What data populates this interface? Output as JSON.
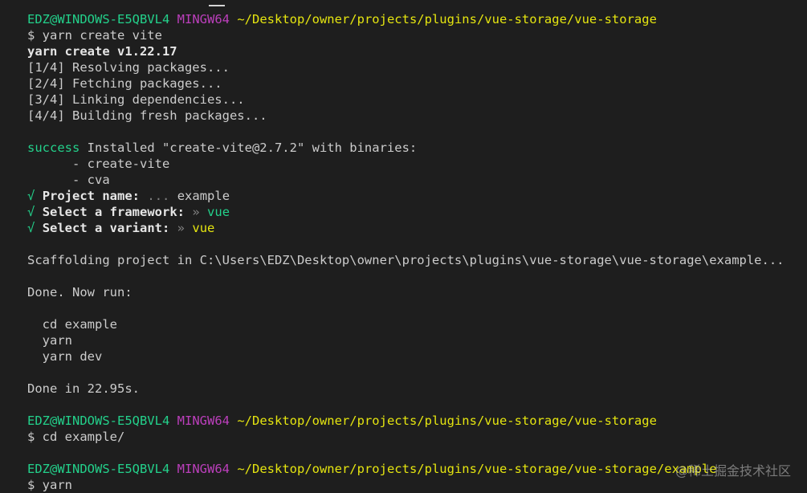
{
  "prompt1": {
    "user": "EDZ@WINDOWS-E5QBVL4",
    "shell": "MINGW64",
    "path": "~/Desktop/owner/projects/plugins/vue-storage/vue-storage"
  },
  "cmd1": "$ yarn create vite",
  "yarn_header": "yarn create v1.22.17",
  "steps": [
    "[1/4] Resolving packages...",
    "[2/4] Fetching packages...",
    "[3/4] Linking dependencies...",
    "[4/4] Building fresh packages..."
  ],
  "success": {
    "label": "success",
    "text": " Installed \"create-vite@2.7.2\" with binaries:",
    "bin1": "      - create-vite",
    "bin2": "      - cva"
  },
  "questions": [
    {
      "check": "√",
      "label": "Project name:",
      "sep": "...",
      "answer": "example"
    },
    {
      "check": "√",
      "label": "Select a framework:",
      "sep": "»",
      "answer": "vue"
    },
    {
      "check": "√",
      "label": "Select a variant:",
      "sep": "»",
      "answer": "vue"
    }
  ],
  "scaffold": "Scaffolding project in C:\\Users\\EDZ\\Desktop\\owner\\projects\\plugins\\vue-storage\\vue-storage\\example...",
  "done_now": "Done. Now run:",
  "run_cmds": [
    "  cd example",
    "  yarn",
    "  yarn dev"
  ],
  "done_in": "Done in 22.95s.",
  "prompt2": {
    "user": "EDZ@WINDOWS-E5QBVL4",
    "shell": "MINGW64",
    "path": "~/Desktop/owner/projects/plugins/vue-storage/vue-storage"
  },
  "cmd2": "$ cd example/",
  "prompt3": {
    "user": "EDZ@WINDOWS-E5QBVL4",
    "shell": "MINGW64",
    "path": "~/Desktop/owner/projects/plugins/vue-storage/vue-storage/example"
  },
  "cmd3": "$ yarn",
  "watermark": "@稀土掘金技术社区",
  "colors": {
    "background": "#1e1e1e",
    "text": "#cccccc",
    "green": "#23d18b",
    "magenta": "#bc3fbc",
    "yellow": "#e5e510"
  }
}
